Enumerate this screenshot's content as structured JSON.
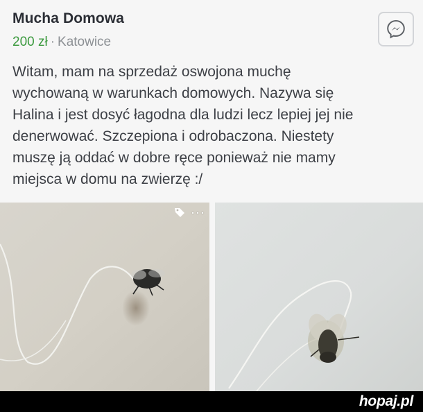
{
  "listing": {
    "title": "Mucha Domowa",
    "price": "200 zł",
    "separator": "·",
    "location": "Katowice",
    "description": "Witam, mam na sprzedaż oswojona muchę\nwychowaną w warunkach domowych. Nazywa się\nHalina i jest dosyć łagodna dla ludzi lecz lepiej jej nie\ndenerwować. Szczepiona i odrobaczona. Niestety\nmuszę ją oddać w dobre ręce ponieważ nie mamy\nmiejsca w domu na zwierzę :/"
  },
  "icons": {
    "messenger": "messenger-icon",
    "tag": "tag-icon",
    "more": "more-icon"
  },
  "photo_tools": {
    "more_label": "···"
  },
  "watermark": "hopaj.pl",
  "colors": {
    "price": "#3c9a3f",
    "title": "#2b2e35",
    "muted": "#8c9094",
    "footer_bg": "#000000"
  }
}
